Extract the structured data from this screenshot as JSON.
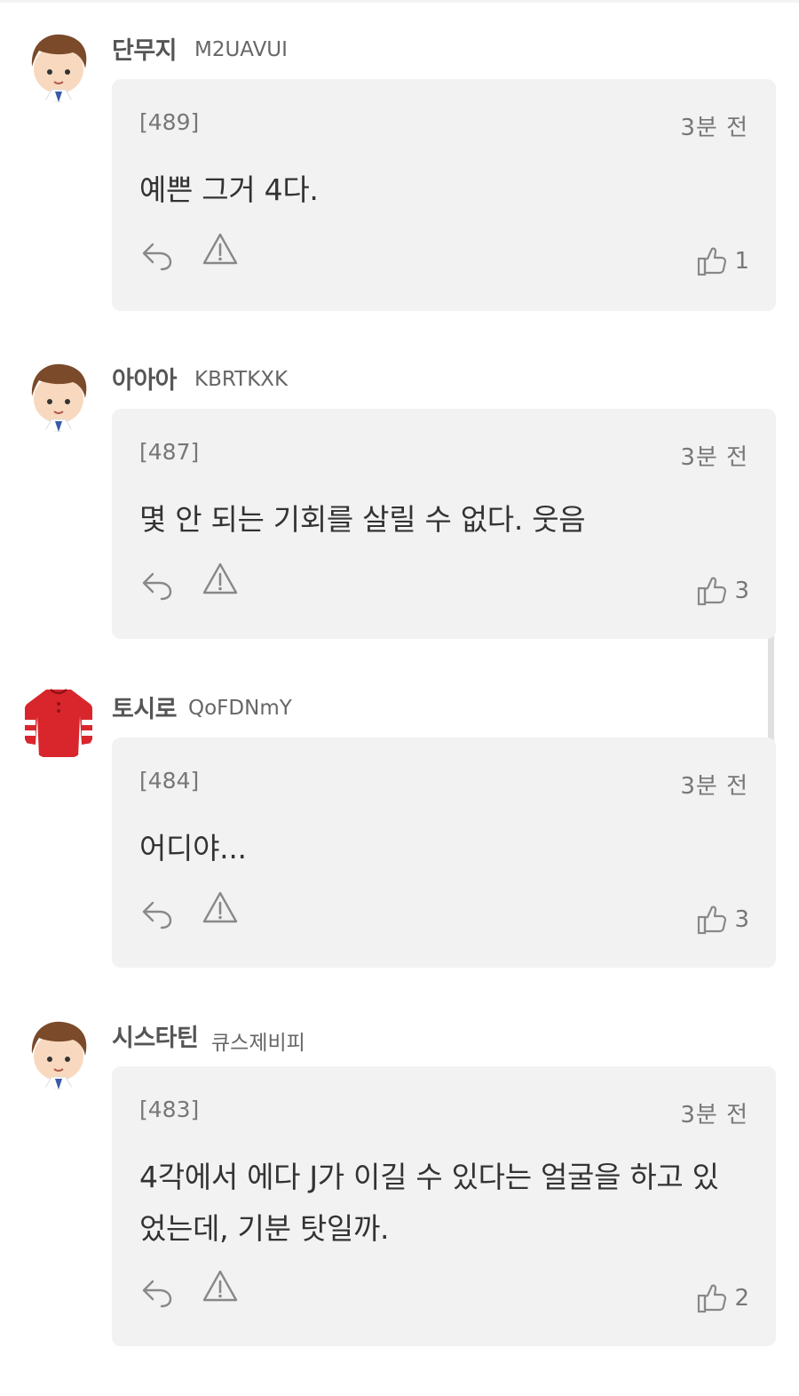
{
  "comments": [
    {
      "username": "단무지",
      "userid": "M2UAVUI",
      "avatar_icon": "boy-avatar-icon",
      "number": "[489]",
      "time": "3분 전",
      "text": "예쁜 그거 4다.",
      "likes": "1"
    },
    {
      "username": "아아아",
      "userid": "KBRTKXK",
      "avatar_icon": "boy-avatar-icon",
      "number": "[487]",
      "time": "3분 전",
      "text": "몇 안 되는 기회를 살릴 수 없다. 웃음",
      "likes": "3"
    },
    {
      "username": "토시로",
      "userid": "QoFDNmY",
      "avatar_icon": "red-jersey-avatar-icon",
      "number": "[484]",
      "time": "3분 전",
      "text": "어디야...",
      "likes": "3"
    },
    {
      "username": "시스타틴",
      "userid": "큐스제비피",
      "avatar_icon": "boy-avatar-icon",
      "number": "[483]",
      "time": "3분 전",
      "text": "4각에서 에다 J가 이길 수 있다는 얼굴을 하고 있었는데, 기분 탓일까.",
      "likes": "2"
    }
  ],
  "colors": {
    "card_background": "#f2f2f2",
    "username": "#555555",
    "text": "#333333",
    "meta": "#777777",
    "icon": "#888888"
  }
}
